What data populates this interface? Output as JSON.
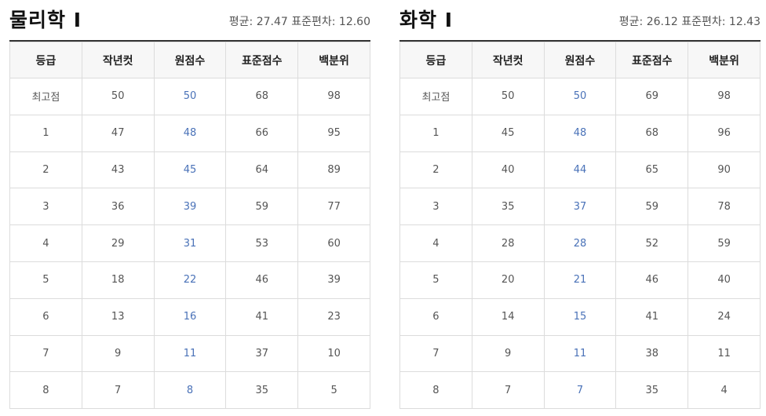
{
  "columns": [
    "등급",
    "작년컷",
    "원점수",
    "표준점수",
    "백분위"
  ],
  "panels": [
    {
      "title": "물리학 Ⅰ",
      "stats": "평균: 27.47 표준편차: 12.60",
      "rows": [
        [
          "최고점",
          "50",
          "50",
          "68",
          "98"
        ],
        [
          "1",
          "47",
          "48",
          "66",
          "95"
        ],
        [
          "2",
          "43",
          "45",
          "64",
          "89"
        ],
        [
          "3",
          "36",
          "39",
          "59",
          "77"
        ],
        [
          "4",
          "29",
          "31",
          "53",
          "60"
        ],
        [
          "5",
          "18",
          "22",
          "46",
          "39"
        ],
        [
          "6",
          "13",
          "16",
          "41",
          "23"
        ],
        [
          "7",
          "9",
          "11",
          "37",
          "10"
        ],
        [
          "8",
          "7",
          "8",
          "35",
          "5"
        ]
      ]
    },
    {
      "title": "화학 Ⅰ",
      "stats": "평균: 26.12 표준편차: 12.43",
      "rows": [
        [
          "최고점",
          "50",
          "50",
          "69",
          "98"
        ],
        [
          "1",
          "45",
          "48",
          "68",
          "96"
        ],
        [
          "2",
          "40",
          "44",
          "65",
          "90"
        ],
        [
          "3",
          "35",
          "37",
          "59",
          "78"
        ],
        [
          "4",
          "28",
          "28",
          "52",
          "59"
        ],
        [
          "5",
          "20",
          "21",
          "46",
          "40"
        ],
        [
          "6",
          "14",
          "15",
          "41",
          "24"
        ],
        [
          "7",
          "9",
          "11",
          "38",
          "11"
        ],
        [
          "8",
          "7",
          "7",
          "35",
          "4"
        ]
      ]
    }
  ],
  "colors": {
    "raw_score": "#4a72b8",
    "header_bg": "#f7f7f7",
    "border": "#dcdcdc"
  }
}
